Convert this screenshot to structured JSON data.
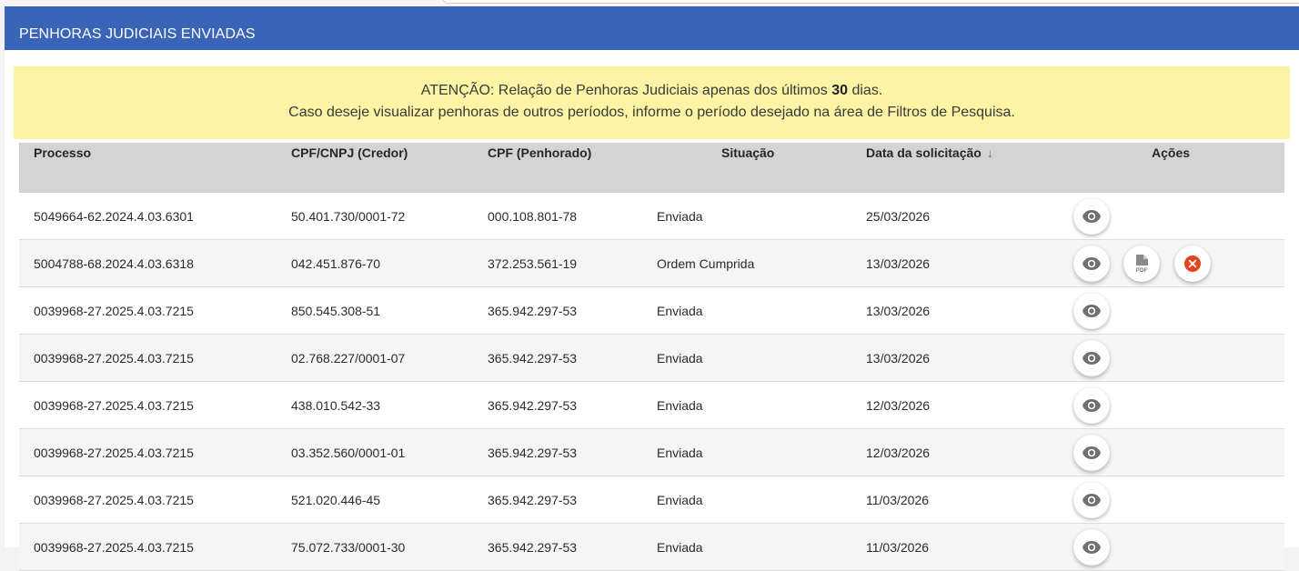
{
  "header": {
    "title": "PENHORAS JUDICIAIS ENVIADAS"
  },
  "alert": {
    "prefix": "ATENÇÃO: Relação de Penhoras Judiciais apenas dos últimos ",
    "days": "30",
    "suffix": " dias.",
    "line2": "Caso deseje visualizar penhoras de outros períodos, informe o período desejado na área de Filtros de Pesquisa."
  },
  "table": {
    "columns": [
      "Processo",
      "CPF/CNPJ (Credor)",
      "CPF (Penhorado)",
      "Situação",
      "Data da solicitação",
      "Ações"
    ],
    "sort_indicator": "↓",
    "rows": [
      {
        "processo": "5049664-62.2024.4.03.6301",
        "credor": "50.401.730/0001-72",
        "penhorado": "000.108.801-78",
        "situacao": "Enviada",
        "data": "25/03/2026",
        "actions": [
          "view"
        ]
      },
      {
        "processo": "5004788-68.2024.4.03.6318",
        "credor": "042.451.876-70",
        "penhorado": "372.253.561-19",
        "situacao": "Ordem Cumprida",
        "data": "13/03/2026",
        "actions": [
          "view",
          "pdf",
          "cancel"
        ]
      },
      {
        "processo": "0039968-27.2025.4.03.7215",
        "credor": "850.545.308-51",
        "penhorado": "365.942.297-53",
        "situacao": "Enviada",
        "data": "13/03/2026",
        "actions": [
          "view"
        ]
      },
      {
        "processo": "0039968-27.2025.4.03.7215",
        "credor": "02.768.227/0001-07",
        "penhorado": "365.942.297-53",
        "situacao": "Enviada",
        "data": "13/03/2026",
        "actions": [
          "view"
        ]
      },
      {
        "processo": "0039968-27.2025.4.03.7215",
        "credor": "438.010.542-33",
        "penhorado": "365.942.297-53",
        "situacao": "Enviada",
        "data": "12/03/2026",
        "actions": [
          "view"
        ]
      },
      {
        "processo": "0039968-27.2025.4.03.7215",
        "credor": "03.352.560/0001-01",
        "penhorado": "365.942.297-53",
        "situacao": "Enviada",
        "data": "12/03/2026",
        "actions": [
          "view"
        ]
      },
      {
        "processo": "0039968-27.2025.4.03.7215",
        "credor": "521.020.446-45",
        "penhorado": "365.942.297-53",
        "situacao": "Enviada",
        "data": "11/03/2026",
        "actions": [
          "view"
        ]
      },
      {
        "processo": "0039968-27.2025.4.03.7215",
        "credor": "75.072.733/0001-30",
        "penhorado": "365.942.297-53",
        "situacao": "Enviada",
        "data": "11/03/2026",
        "actions": [
          "view"
        ]
      }
    ]
  },
  "icons": {
    "view": "eye-icon",
    "pdf": "pdf-file-icon",
    "cancel": "cancel-x-icon"
  },
  "colors": {
    "header_bg": "#3a64b8",
    "alert_bg": "#fbf4a4",
    "table_header_bg": "#d4d4d4",
    "cancel_red": "#e8431a"
  }
}
